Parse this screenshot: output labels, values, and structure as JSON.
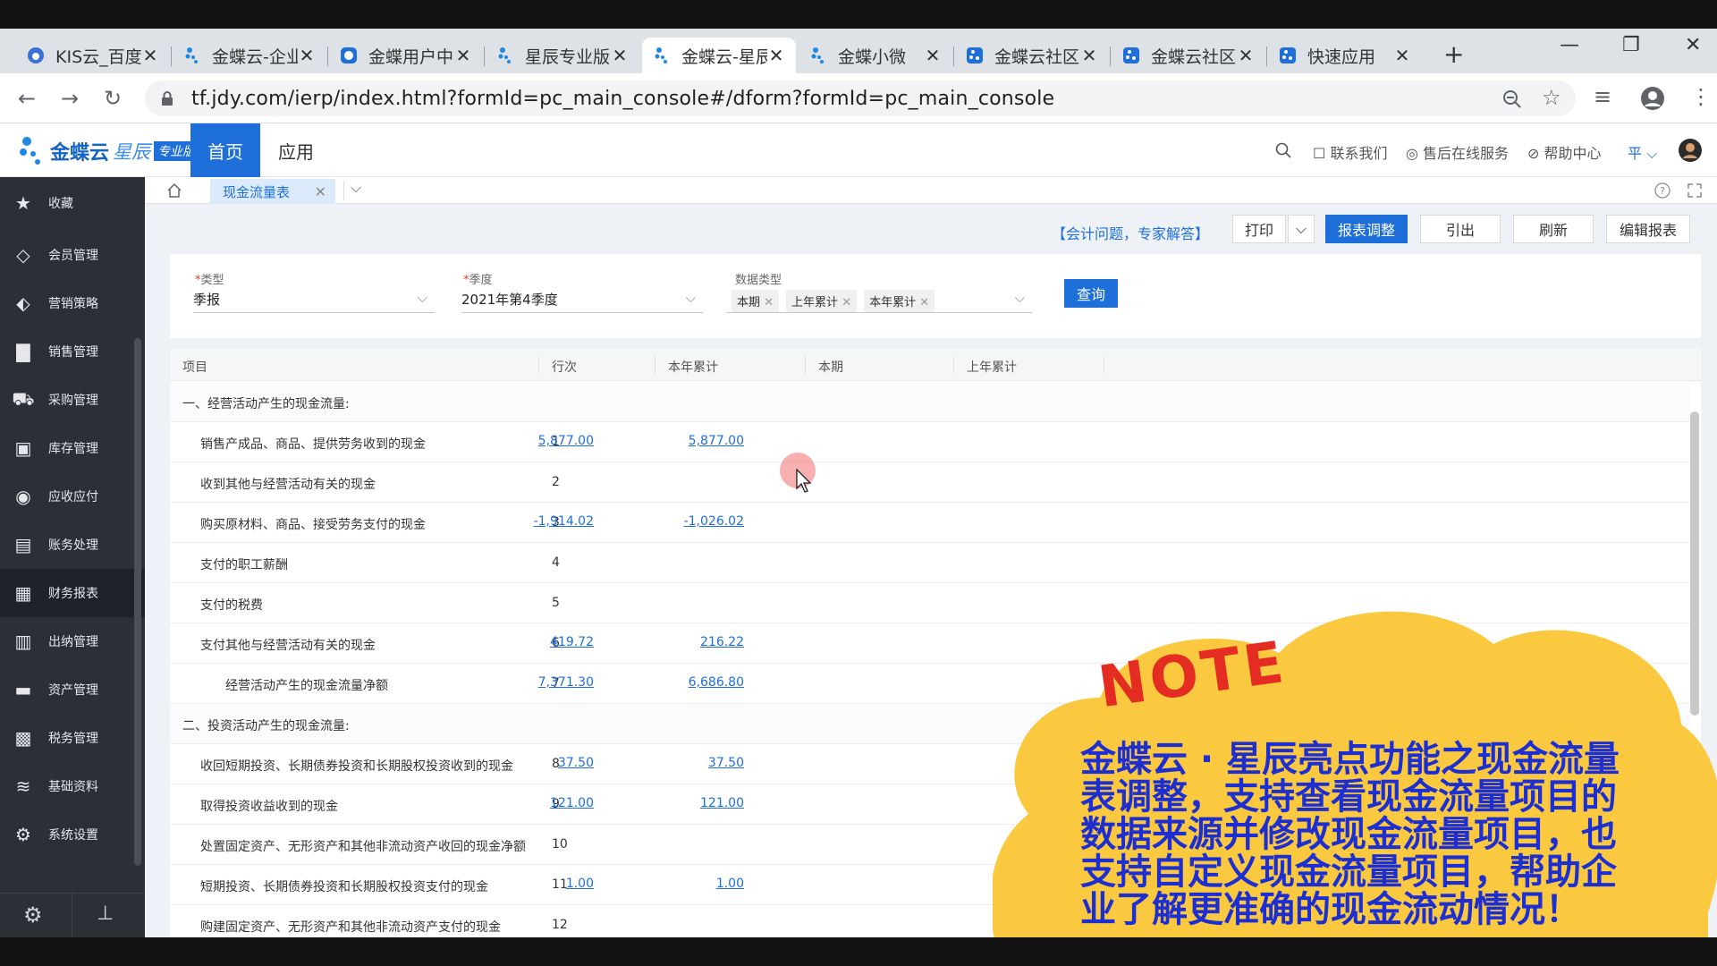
{
  "browser": {
    "tabs": [
      {
        "title": "KIS云_百度",
        "icon": "paw-icon"
      },
      {
        "title": "金蝶云-企业",
        "icon": "kingdee-dots-icon"
      },
      {
        "title": "金蝶用户中心",
        "icon": "cloud-icon"
      },
      {
        "title": "星辰专业版",
        "icon": "kingdee-dots-icon"
      },
      {
        "title": "金蝶云-星辰",
        "icon": "kingdee-dots-icon"
      },
      {
        "title": "金蝶小微",
        "icon": "kingdee-dots-icon"
      },
      {
        "title": "金蝶云社区",
        "icon": "kingdee-square-icon"
      },
      {
        "title": "金蝶云社区",
        "icon": "kingdee-square-icon"
      },
      {
        "title": "快速应用",
        "icon": "kingdee-square-icon"
      }
    ],
    "active_tab_index": 4,
    "new_tab": "+",
    "url": "tf.jdy.com/ierp/index.html?formId=pc_main_console#/dform?formId=pc_main_console"
  },
  "app": {
    "logo_main": "金蝶云",
    "logo_sub": "星辰",
    "logo_badge": "专业版",
    "nav_home": "首页",
    "nav_apps": "应用",
    "contact": "联系我们",
    "service": "售后在线服务",
    "help": "帮助中心",
    "user_initial": "平",
    "brand_color": "#1e6fd9"
  },
  "sidebar": {
    "items": [
      {
        "label": "收藏",
        "icon": "star-icon"
      },
      {
        "label": "会员管理",
        "icon": "diamond-icon"
      },
      {
        "label": "营销策略",
        "icon": "tag-icon"
      },
      {
        "label": "销售管理",
        "icon": "bar-chart-icon"
      },
      {
        "label": "采购管理",
        "icon": "cart-icon"
      },
      {
        "label": "库存管理",
        "icon": "box-icon"
      },
      {
        "label": "应收应付",
        "icon": "coin-icon"
      },
      {
        "label": "账务处理",
        "icon": "ledger-icon"
      },
      {
        "label": "财务报表",
        "icon": "report-icon"
      },
      {
        "label": "出纳管理",
        "icon": "cashier-icon"
      },
      {
        "label": "资产管理",
        "icon": "asset-icon"
      },
      {
        "label": "税务管理",
        "icon": "tax-icon"
      },
      {
        "label": "基础资料",
        "icon": "layers-icon"
      },
      {
        "label": "系统设置",
        "icon": "gear-icon"
      }
    ],
    "active_index": 8
  },
  "page_tab": {
    "label": "现金流量表"
  },
  "toolbar": {
    "expert_link": "【会计问题，专家解答】",
    "print": "打印",
    "adjust": "报表调整",
    "export": "引出",
    "refresh": "刷新",
    "edit": "编辑报表"
  },
  "filter": {
    "type_label": "类型",
    "type_value": "季报",
    "quarter_label": "季度",
    "quarter_value": "2021年第4季度",
    "datatype_label": "数据类型",
    "chips": [
      "本期",
      "上年累计",
      "本年累计"
    ],
    "query": "查询"
  },
  "table": {
    "headers": [
      "项目",
      "行次",
      "本年累计",
      "本期",
      "上年累计"
    ],
    "rows": [
      {
        "item": "一、经营活动产生的现金流量:",
        "no": "",
        "ytd": "",
        "cur": "",
        "indent": 0
      },
      {
        "item": "销售产成品、商品、提供劳务收到的现金",
        "no": "1",
        "ytd": "5,877.00",
        "cur": "5,877.00",
        "indent": 1
      },
      {
        "item": "收到其他与经营活动有关的现金",
        "no": "2",
        "ytd": "",
        "cur": "",
        "indent": 1
      },
      {
        "item": "购买原材料、商品、接受劳务支付的现金",
        "no": "3",
        "ytd": "-1,914.02",
        "cur": "-1,026.02",
        "indent": 1
      },
      {
        "item": "支付的职工薪酬",
        "no": "4",
        "ytd": "",
        "cur": "",
        "indent": 1
      },
      {
        "item": "支付的税费",
        "no": "5",
        "ytd": "",
        "cur": "",
        "indent": 1
      },
      {
        "item": "支付其他与经营活动有关的现金",
        "no": "6",
        "ytd": "419.72",
        "cur": "216.22",
        "indent": 1
      },
      {
        "item": "经营活动产生的现金流量净额",
        "no": "7",
        "ytd": "7,371.30",
        "cur": "6,686.80",
        "indent": 2
      },
      {
        "item": "二、投资活动产生的现金流量:",
        "no": "",
        "ytd": "",
        "cur": "",
        "indent": 0
      },
      {
        "item": "收回短期投资、长期债券投资和长期股权投资收到的现金",
        "no": "8",
        "ytd": "37.50",
        "cur": "37.50",
        "indent": 1
      },
      {
        "item": "取得投资收益收到的现金",
        "no": "9",
        "ytd": "121.00",
        "cur": "121.00",
        "indent": 1
      },
      {
        "item": "处置固定资产、无形资产和其他非流动资产收回的现金净额",
        "no": "10",
        "ytd": "",
        "cur": "",
        "indent": 1
      },
      {
        "item": "短期投资、长期债券投资和长期股权投资支付的现金",
        "no": "11",
        "ytd": "1.00",
        "cur": "1.00",
        "indent": 1
      },
      {
        "item": "购建固定资产、无形资产和其他非流动资产支付的现金",
        "no": "12",
        "ytd": "",
        "cur": "",
        "indent": 1
      }
    ]
  },
  "note": {
    "title": "NOTE",
    "text": "金蝶云 · 星辰亮点功能之现金流量表调整，支持查看现金流量项目的数据来源并修改现金流量项目，也支持自定义现金流量项目，帮助企业了解更准确的现金流动情况！"
  }
}
